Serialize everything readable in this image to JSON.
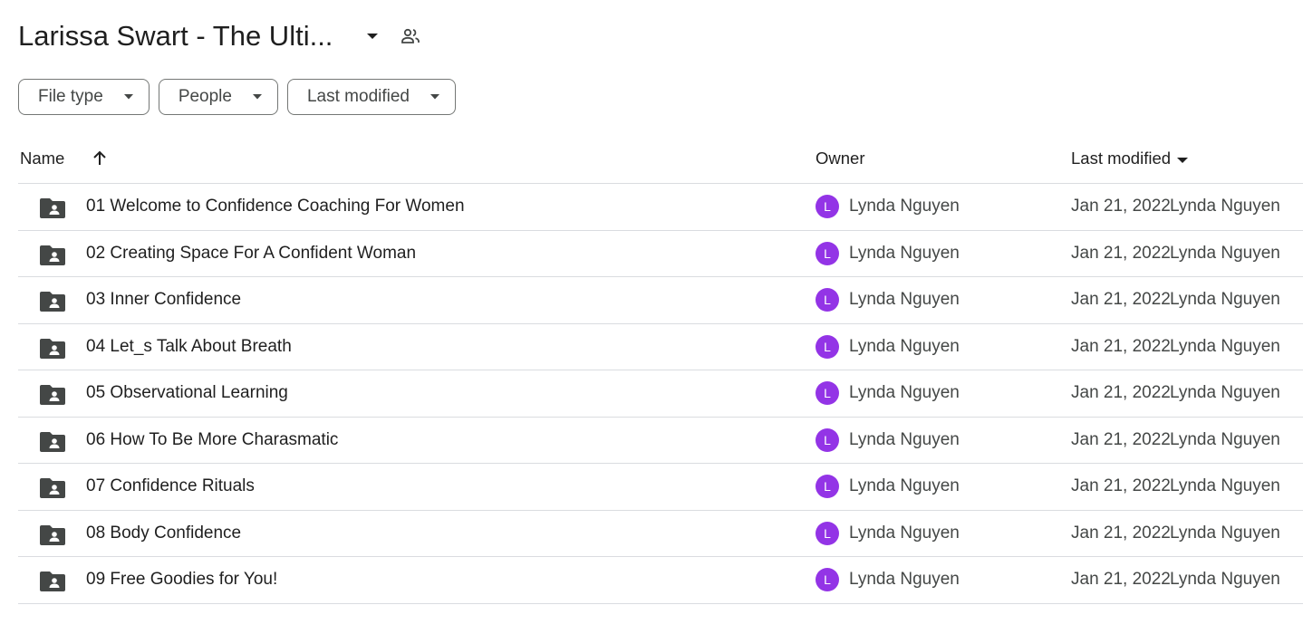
{
  "folder": {
    "title": "Larissa Swart - The Ulti...",
    "dropdown_icon": "arrow-drop-down-icon",
    "shared_icon": "people-icon"
  },
  "filters": [
    {
      "label": "File type"
    },
    {
      "label": "People"
    },
    {
      "label": "Last modified"
    }
  ],
  "columns": {
    "name": "Name",
    "owner": "Owner",
    "last_modified": "Last modified",
    "sort_icon": "arrow-upward-icon",
    "sort_caret_icon": "arrow-drop-down-icon"
  },
  "rows": [
    {
      "name": "01 Welcome to Confidence Coaching For Women",
      "owner_initial": "L",
      "owner": "Lynda Nguyen",
      "modified_date": "Jan 21, 2022",
      "modified_by": "Lynda Nguyen"
    },
    {
      "name": "02 Creating Space For A Confident Woman",
      "owner_initial": "L",
      "owner": "Lynda Nguyen",
      "modified_date": "Jan 21, 2022",
      "modified_by": "Lynda Nguyen"
    },
    {
      "name": "03 Inner Confidence",
      "owner_initial": "L",
      "owner": "Lynda Nguyen",
      "modified_date": "Jan 21, 2022",
      "modified_by": "Lynda Nguyen"
    },
    {
      "name": "04 Let_s Talk About Breath",
      "owner_initial": "L",
      "owner": "Lynda Nguyen",
      "modified_date": "Jan 21, 2022",
      "modified_by": "Lynda Nguyen"
    },
    {
      "name": "05 Observational Learning",
      "owner_initial": "L",
      "owner": "Lynda Nguyen",
      "modified_date": "Jan 21, 2022",
      "modified_by": "Lynda Nguyen"
    },
    {
      "name": "06 How To Be More Charasmatic",
      "owner_initial": "L",
      "owner": "Lynda Nguyen",
      "modified_date": "Jan 21, 2022",
      "modified_by": "Lynda Nguyen"
    },
    {
      "name": "07 Confidence Rituals",
      "owner_initial": "L",
      "owner": "Lynda Nguyen",
      "modified_date": "Jan 21, 2022",
      "modified_by": "Lynda Nguyen"
    },
    {
      "name": "08 Body Confidence",
      "owner_initial": "L",
      "owner": "Lynda Nguyen",
      "modified_date": "Jan 21, 2022",
      "modified_by": "Lynda Nguyen"
    },
    {
      "name": "09 Free Goodies for You!",
      "owner_initial": "L",
      "owner": "Lynda Nguyen",
      "modified_date": "Jan 21, 2022",
      "modified_by": "Lynda Nguyen"
    }
  ],
  "colors": {
    "avatar": "#9334e6",
    "folder_icon": "#444746",
    "divider": "#dadce0"
  }
}
